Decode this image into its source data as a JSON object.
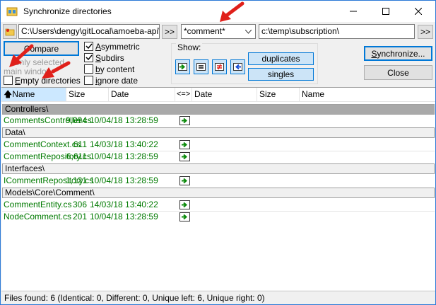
{
  "window": {
    "title": "Synchronize directories"
  },
  "top": {
    "left_path": "C:\\Users\\dengy\\gitLocal\\amoeba-api\\Ar",
    "left_browse": ">>",
    "mask": "*comment*",
    "right_path": "c:\\temp\\subscription\\",
    "right_browse": ">>"
  },
  "options": {
    "compare": "Compare",
    "only_selected": "only selected",
    "main_window": "main window",
    "empty_dirs_underline": "E",
    "empty_dirs_rest": "mpty directories",
    "asymmetric_underline": "A",
    "asymmetric_rest": "symmetric",
    "subdirs_underline": "S",
    "subdirs_rest": "ubdirs",
    "by_content_underline": "b",
    "by_content_rest": "y content",
    "ignore_date_underline": "i",
    "ignore_date_rest": "gnore date"
  },
  "show": {
    "label": "Show:",
    "duplicates": "duplicates",
    "singles": "singles"
  },
  "actions": {
    "synchronize_underline": "S",
    "synchronize_rest": "ynchronize...",
    "close": "Close"
  },
  "columns": {
    "name": "Name",
    "size": "Size",
    "date": "Date",
    "compare": "<=>",
    "date2": "Date",
    "size2": "Size",
    "name2": "Name"
  },
  "groups": [
    {
      "folder": "Controllers\\",
      "files": [
        {
          "name": "CommentsController.cs",
          "size": "9,094",
          "date": "10/04/18 13:28:59"
        }
      ]
    },
    {
      "folder": "Data\\",
      "files": [
        {
          "name": "CommentContext.cs",
          "size": "611",
          "date": "14/03/18 13:40:22"
        },
        {
          "name": "CommentRepository.cs",
          "size": "6,611",
          "date": "10/04/18 13:28:59"
        }
      ]
    },
    {
      "folder": "Interfaces\\",
      "files": [
        {
          "name": "ICommentRepository.cs",
          "size": "1,121",
          "date": "10/04/18 13:28:59"
        }
      ]
    },
    {
      "folder": "Models\\Core\\Comment\\",
      "files": [
        {
          "name": "CommentEntity.cs",
          "size": "306",
          "date": "14/03/18 13:40:22"
        },
        {
          "name": "NodeComment.cs",
          "size": "201",
          "date": "10/04/18 13:28:59"
        }
      ]
    }
  ],
  "status": "Files found: 6  (Identical: 0, Different: 0, Unique left: 6, Unique right: 0)",
  "colors": {
    "file_text": "#007a00",
    "accent": "#0078d7",
    "arrow_red": "#e0201a"
  }
}
